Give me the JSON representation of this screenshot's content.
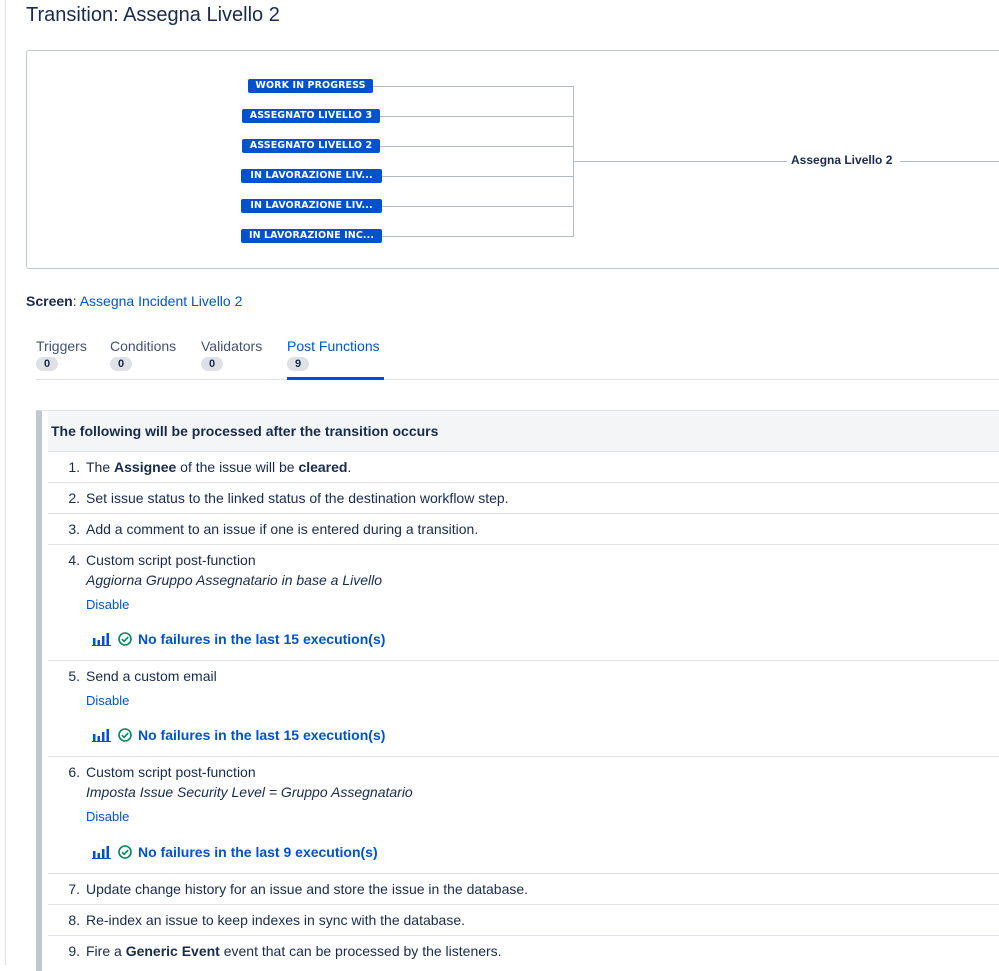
{
  "page": {
    "title": "Transition: Assegna Livello 2"
  },
  "diagram": {
    "source_statuses": [
      "WORK IN PROGRESS",
      "ASSEGNATO LIVELLO 3",
      "ASSEGNATO LIVELLO 2",
      "IN LAVORAZIONE LIV...",
      "IN LAVORAZIONE LIV...",
      "IN LAVORAZIONE INC..."
    ],
    "transition_label": "Assegna Livello 2",
    "status_color": "#0052cc"
  },
  "screen": {
    "label": "Screen",
    "colon": ":",
    "link": "Assegna Incident Livello 2"
  },
  "tabs": [
    {
      "label": "Triggers",
      "count": "0",
      "active": false
    },
    {
      "label": "Conditions",
      "count": "0",
      "active": false
    },
    {
      "label": "Validators",
      "count": "0",
      "active": false
    },
    {
      "label": "Post Functions",
      "count": "9",
      "active": true
    }
  ],
  "post_functions": {
    "header": "The following will be processed after the transition occurs",
    "items": [
      {
        "number": "1.",
        "pre": "The ",
        "b1": "Assignee",
        "mid": " of the issue will be ",
        "b2": "cleared",
        "post": "."
      },
      {
        "number": "2.",
        "text": "Set issue status to the linked status of the destination workflow step."
      },
      {
        "number": "3.",
        "text": "Add a comment to an issue if one is entered during a transition."
      },
      {
        "number": "4.",
        "text": "Custom script post-function",
        "description": "Aggiorna Gruppo Assegnatario in base a Livello",
        "disable_label": "Disable",
        "status": "No failures in the last 15 execution(s)",
        "chart_icon": "bar-chart-icon",
        "status_icon": "check-circle-icon"
      },
      {
        "number": "5.",
        "text": "Send a custom email",
        "disable_label": "Disable",
        "status": "No failures in the last 15 execution(s)",
        "chart_icon": "bar-chart-icon",
        "status_icon": "check-circle-icon"
      },
      {
        "number": "6.",
        "text": "Custom script post-function",
        "description": "Imposta Issue Security Level = Gruppo Assegnatario",
        "disable_label": "Disable",
        "status": "No failures in the last 9 execution(s)",
        "chart_icon": "bar-chart-icon",
        "status_icon": "check-circle-icon"
      },
      {
        "number": "7.",
        "text": "Update change history for an issue and store the issue in the database."
      },
      {
        "number": "8.",
        "text": "Re-index an issue to keep indexes in sync with the database."
      },
      {
        "number": "9.",
        "pre": "Fire a ",
        "b1": "Generic Event",
        "post": " event that can be processed by the listeners."
      }
    ]
  },
  "colors": {
    "link": "#0052cc",
    "success": "#00875a",
    "text": "#172b4d"
  }
}
